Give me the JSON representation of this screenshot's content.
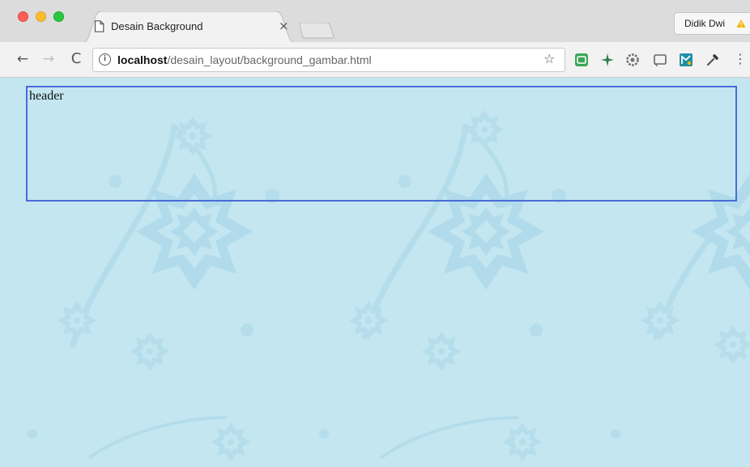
{
  "window": {
    "tab": {
      "title": "Desain Background",
      "close_glyph": "×",
      "icon": "page-icon"
    },
    "new_tab_icon": "new-tab-icon",
    "profile": {
      "name": "Didik Dwi",
      "badge_icon": "warning-icon"
    }
  },
  "toolbar": {
    "back_glyph": "←",
    "forward_glyph": "→",
    "reload_glyph": "C",
    "address": {
      "info_glyph": "i",
      "host": "localhost",
      "path": "/desain_layout/background_gambar.html"
    },
    "bookmark_glyph": "☆",
    "extensions": [
      "extension-green-icon",
      "extension-sparkle-icon",
      "extension-gear-icon",
      "cast-icon",
      "extension-teal-icon",
      "eyedropper-icon"
    ],
    "menu_glyph": "⋮"
  },
  "page": {
    "header_text": "header",
    "background_color": "#c3e6f1",
    "header_border_color": "#4a6bd8"
  }
}
